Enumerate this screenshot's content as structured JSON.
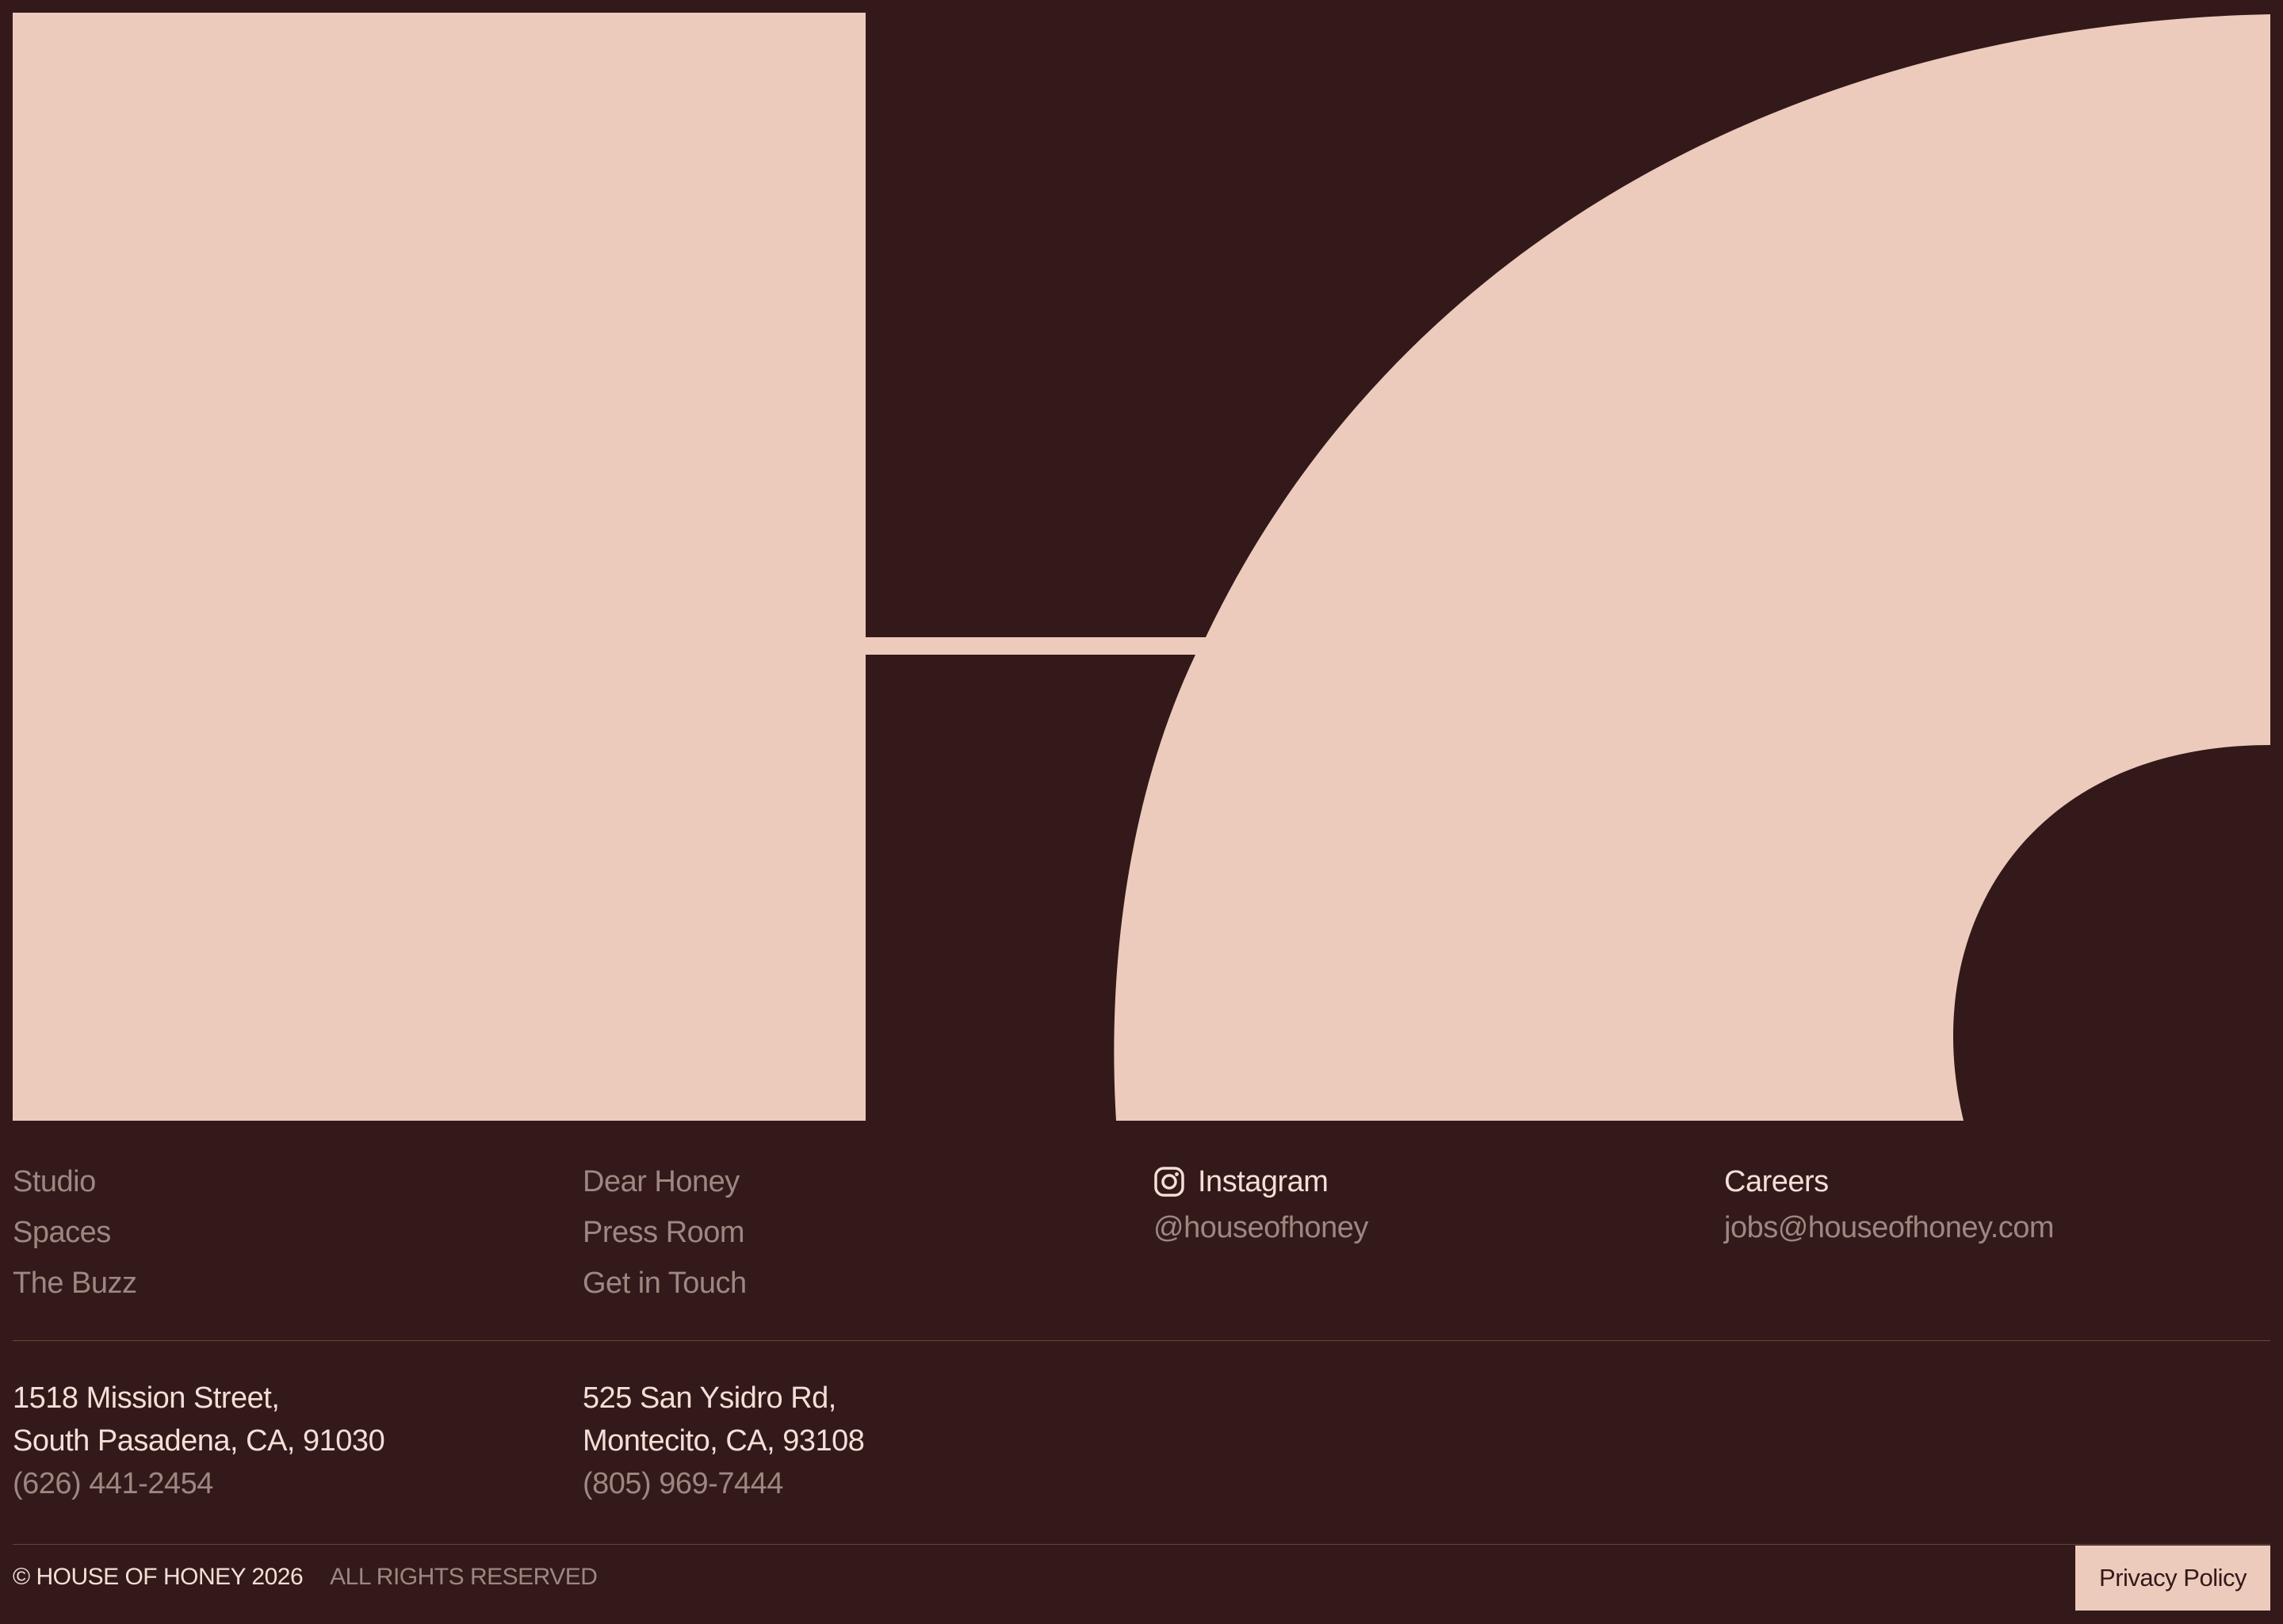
{
  "colors": {
    "background": "#33191a",
    "accent": "#edcbbc",
    "text_primary": "#f3dfd6",
    "text_muted": "#9d8780",
    "divider": "#6a4636"
  },
  "logo": {
    "icon": "house-of-honey-logo-mark"
  },
  "nav": {
    "column_1": [
      "Studio",
      "Spaces",
      "The Buzz"
    ],
    "column_2": [
      "Dear Honey",
      "Press Room",
      "Get in Touch"
    ]
  },
  "social": {
    "icon": "instagram-icon",
    "label": "Instagram",
    "handle": "@houseofhoney"
  },
  "careers": {
    "label": "Careers",
    "email": "jobs@houseofhoney.com"
  },
  "locations": [
    {
      "line1": "1518 Mission Street,",
      "line2": "South Pasadena, CA, 91030",
      "phone": "(626) 441-2454"
    },
    {
      "line1": "525 San Ysidro Rd,",
      "line2": "Montecito, CA, 93108",
      "phone": "(805) 969-7444"
    }
  ],
  "footer": {
    "copyright": "© HOUSE OF HONEY 2026",
    "rights": "ALL RIGHTS RESERVED",
    "privacy_label": "Privacy Policy"
  }
}
